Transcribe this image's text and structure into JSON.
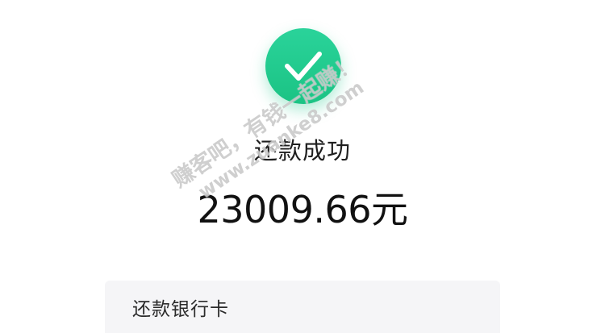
{
  "result": {
    "icon": "checkmark-circle-icon",
    "status_text": "还款成功",
    "amount_text": "23009.66元"
  },
  "detail": {
    "bank_card_label": "还款银行卡"
  },
  "watermark": {
    "line1": "赚客吧，有钱一起赚！",
    "line2": "www.zuanke8.com"
  },
  "colors": {
    "success": "#20C98A",
    "card_bg": "#F5F5F7",
    "text": "#1F1F1F"
  }
}
